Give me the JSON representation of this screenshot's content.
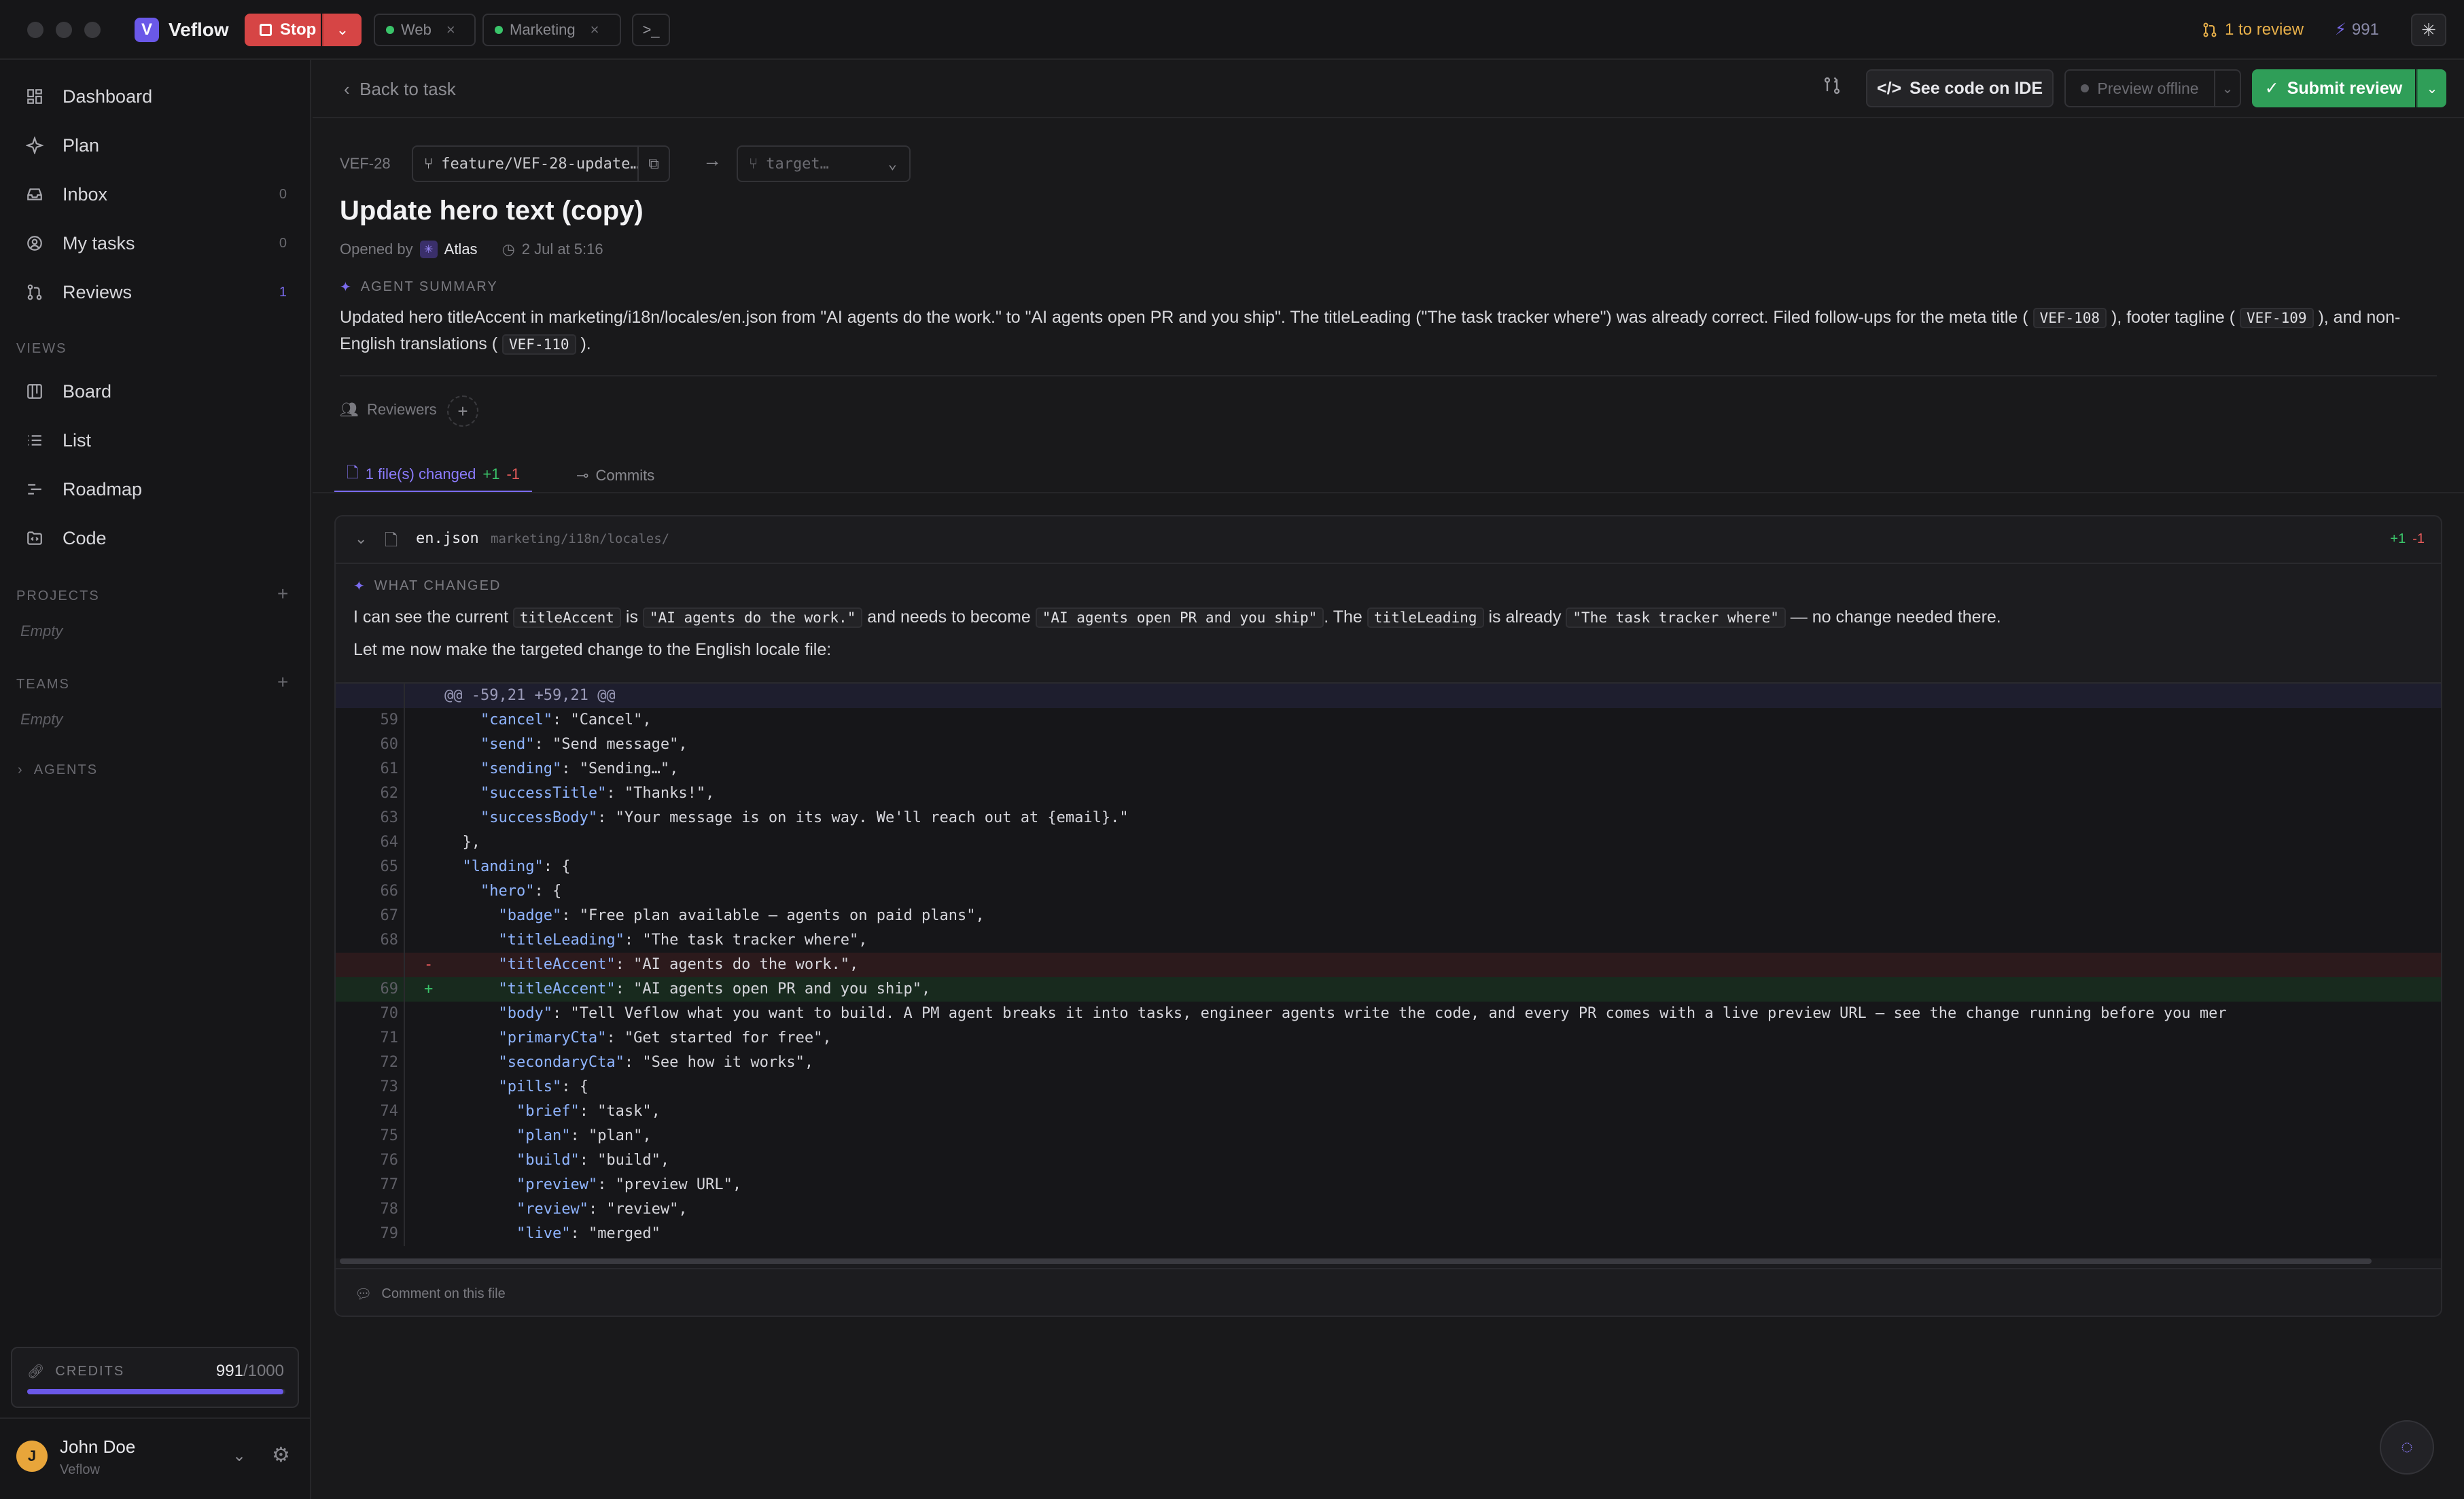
{
  "app": {
    "name": "Veflow",
    "logo_letter": "V",
    "accent": "#6a58e8"
  },
  "topbar": {
    "stop_label": "Stop",
    "tabs": [
      {
        "label": "Web",
        "status_color": "#3ac46a"
      },
      {
        "label": "Marketing",
        "status_color": "#3ac46a"
      }
    ],
    "to_review": "1 to review",
    "credits": "991"
  },
  "sidebar": {
    "items": [
      {
        "label": "Dashboard",
        "icon": "dashboard-icon",
        "count": ""
      },
      {
        "label": "Plan",
        "icon": "sparkle-icon",
        "count": ""
      },
      {
        "label": "Inbox",
        "icon": "inbox-icon",
        "count": "0"
      },
      {
        "label": "My tasks",
        "icon": "user-circle-icon",
        "count": "0"
      },
      {
        "label": "Reviews",
        "icon": "git-pull-request-icon",
        "count": "1"
      }
    ],
    "views_label": "VIEWS",
    "views": [
      {
        "label": "Board",
        "icon": "board-icon"
      },
      {
        "label": "List",
        "icon": "list-icon"
      },
      {
        "label": "Roadmap",
        "icon": "roadmap-icon"
      },
      {
        "label": "Code",
        "icon": "code-folder-icon"
      }
    ],
    "projects_label": "PROJECTS",
    "projects_empty": "Empty",
    "teams_label": "TEAMS",
    "teams_empty": "Empty",
    "agents_label": "AGENTS",
    "credits_label": "CREDITS",
    "credits_used": "991",
    "credits_total": "/1000",
    "credits_fraction": 0.991,
    "user": {
      "name": "John Doe",
      "org": "Veflow",
      "initial": "J"
    }
  },
  "header": {
    "back_label": "Back to task",
    "see_code_label": "See code on IDE",
    "preview_label": "Preview offline",
    "submit_label": "Submit review"
  },
  "task": {
    "id": "VEF-28",
    "branch": "feature/VEF-28-update…",
    "target_placeholder": "target…",
    "title": "Update hero text (copy)",
    "opened_by_label": "Opened by",
    "opened_by": "Atlas",
    "opened_at": "2 Jul at 5:16",
    "summary_label": "AGENT SUMMARY",
    "summary_parts": {
      "p1": "Updated hero titleAccent in marketing/i18n/locales/en.json from \"AI agents do the work.\" to \"AI agents open PR and you ship\". The titleLeading (\"The task tracker where\") was already correct. Filed follow-ups for the meta title (",
      "c1": "VEF-108",
      "p2": "), footer tagline (",
      "c2": "VEF-109",
      "p3": "), and non-English translations (",
      "c3": "VEF-110",
      "p4": ")."
    },
    "reviewers_label": "Reviewers"
  },
  "tabs": {
    "files_label": "1 file(s) changed",
    "files_add": "+1",
    "files_del": "-1",
    "commits_label": "Commits"
  },
  "file": {
    "name": "en.json",
    "path": "marketing/i18n/locales/",
    "add": "+1",
    "del": "-1",
    "what_changed_label": "WHAT CHANGED",
    "wc": {
      "t1": "I can see the current",
      "c1": "titleAccent",
      "t2": "is",
      "c2": "\"AI agents do the work.\"",
      "t3": "and needs to become",
      "c3": "\"AI agents open PR and you ship\"",
      "t4": ". The",
      "c4": "titleLeading",
      "t5": "is already",
      "c5": "\"The task tracker where\"",
      "t6": "— no change needed there."
    },
    "wc_line2": "Let me now make the targeted change to the English locale file:",
    "hunk": "@@ -59,21 +59,21 @@",
    "lines": [
      {
        "ln": "59",
        "t": "ctx",
        "k": "\"cancel\"",
        "v": ": \"Cancel\",",
        "ind": "    "
      },
      {
        "ln": "60",
        "t": "ctx",
        "k": "\"send\"",
        "v": ": \"Send message\",",
        "ind": "    "
      },
      {
        "ln": "61",
        "t": "ctx",
        "k": "\"sending\"",
        "v": ": \"Sending…\",",
        "ind": "    "
      },
      {
        "ln": "62",
        "t": "ctx",
        "k": "\"successTitle\"",
        "v": ": \"Thanks!\",",
        "ind": "    "
      },
      {
        "ln": "63",
        "t": "ctx",
        "k": "\"successBody\"",
        "v": ": \"Your message is on its way. We'll reach out at {email}.\"",
        "ind": "    "
      },
      {
        "ln": "64",
        "t": "ctx",
        "k": "",
        "v": "},",
        "ind": "  "
      },
      {
        "ln": "65",
        "t": "ctx",
        "k": "\"landing\"",
        "v": ": {",
        "ind": "  "
      },
      {
        "ln": "66",
        "t": "ctx",
        "k": "\"hero\"",
        "v": ": {",
        "ind": "    "
      },
      {
        "ln": "67",
        "t": "ctx",
        "k": "\"badge\"",
        "v": ": \"Free plan available — agents on paid plans\",",
        "ind": "      "
      },
      {
        "ln": "68",
        "t": "ctx",
        "k": "\"titleLeading\"",
        "v": ": \"The task tracker where\",",
        "ind": "      "
      },
      {
        "ln": "",
        "t": "del",
        "k": "\"titleAccent\"",
        "v": ": \"AI agents do the work.\",",
        "ind": "      "
      },
      {
        "ln": "69",
        "t": "add",
        "k": "\"titleAccent\"",
        "v": ": \"AI agents open PR and you ship\",",
        "ind": "      "
      },
      {
        "ln": "70",
        "t": "ctx",
        "k": "\"body\"",
        "v": ": \"Tell Veflow what you want to build. A PM agent breaks it into tasks, engineer agents write the code, and every PR comes with a live preview URL — see the change running before you mer",
        "ind": "      "
      },
      {
        "ln": "71",
        "t": "ctx",
        "k": "\"primaryCta\"",
        "v": ": \"Get started for free\",",
        "ind": "      "
      },
      {
        "ln": "72",
        "t": "ctx",
        "k": "\"secondaryCta\"",
        "v": ": \"See how it works\",",
        "ind": "      "
      },
      {
        "ln": "73",
        "t": "ctx",
        "k": "\"pills\"",
        "v": ": {",
        "ind": "      "
      },
      {
        "ln": "74",
        "t": "ctx",
        "k": "\"brief\"",
        "v": ": \"task\",",
        "ind": "        "
      },
      {
        "ln": "75",
        "t": "ctx",
        "k": "\"plan\"",
        "v": ": \"plan\",",
        "ind": "        "
      },
      {
        "ln": "76",
        "t": "ctx",
        "k": "\"build\"",
        "v": ": \"build\",",
        "ind": "        "
      },
      {
        "ln": "77",
        "t": "ctx",
        "k": "\"preview\"",
        "v": ": \"preview URL\",",
        "ind": "        "
      },
      {
        "ln": "78",
        "t": "ctx",
        "k": "\"review\"",
        "v": ": \"review\",",
        "ind": "        "
      },
      {
        "ln": "79",
        "t": "ctx",
        "k": "\"live\"",
        "v": ": \"merged\"",
        "ind": "        "
      }
    ],
    "comment_label": "Comment on this file"
  }
}
